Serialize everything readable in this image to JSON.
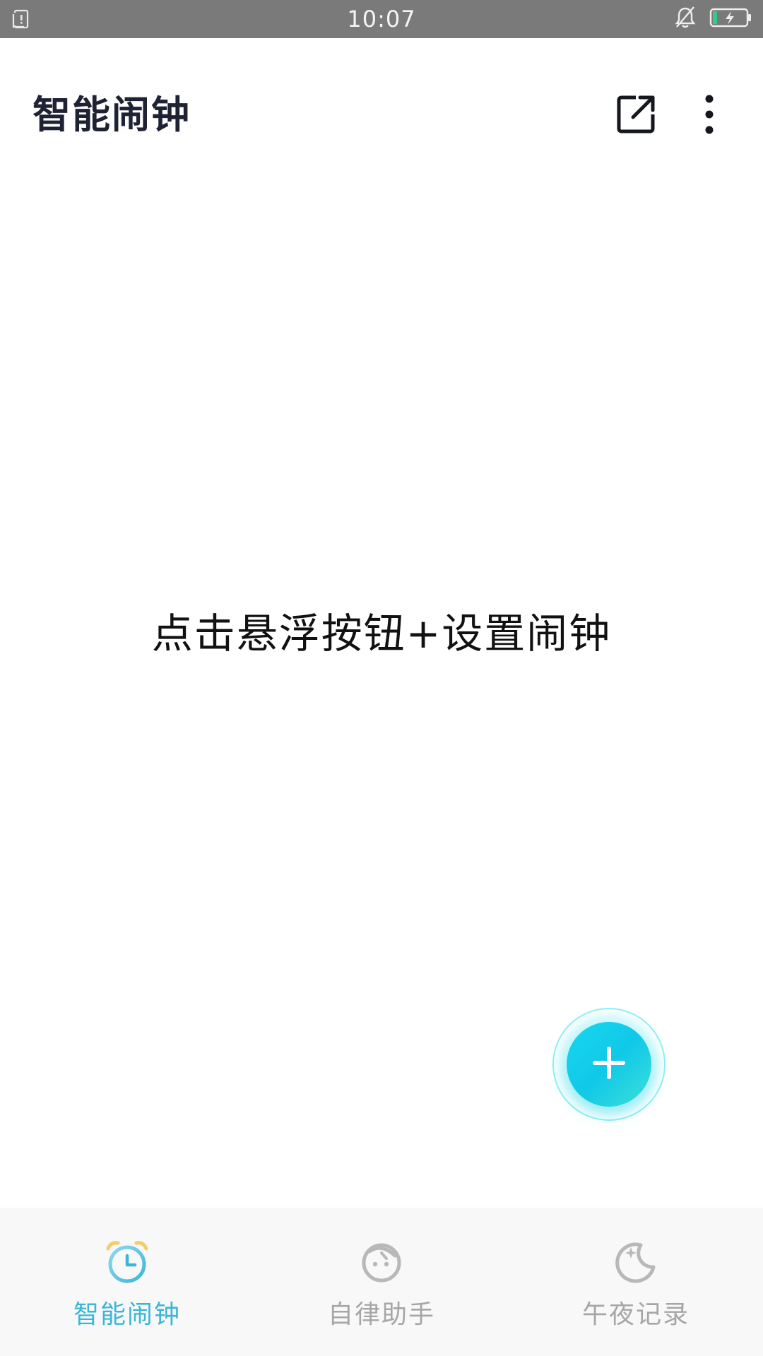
{
  "status_bar": {
    "time": "10:07",
    "left_icon": "sim-card-alert-icon",
    "right_icons": [
      "bell-muted-icon",
      "battery-charging-icon"
    ]
  },
  "app_bar": {
    "title": "智能闹钟",
    "actions": [
      {
        "icon": "share-external-icon"
      },
      {
        "icon": "more-vertical-icon"
      }
    ]
  },
  "main": {
    "empty_hint": "点击悬浮按钮+设置闹钟"
  },
  "fab": {
    "icon": "plus-icon",
    "color": "#18d8ee"
  },
  "bottom_nav": {
    "active_index": 0,
    "active_color": "#3ab6d8",
    "inactive_color": "#a6a6a6",
    "items": [
      {
        "label": "智能闹钟",
        "icon": "alarm-clock-icon"
      },
      {
        "label": "自律助手",
        "icon": "face-timer-icon"
      },
      {
        "label": "午夜记录",
        "icon": "moon-stars-icon"
      }
    ]
  }
}
